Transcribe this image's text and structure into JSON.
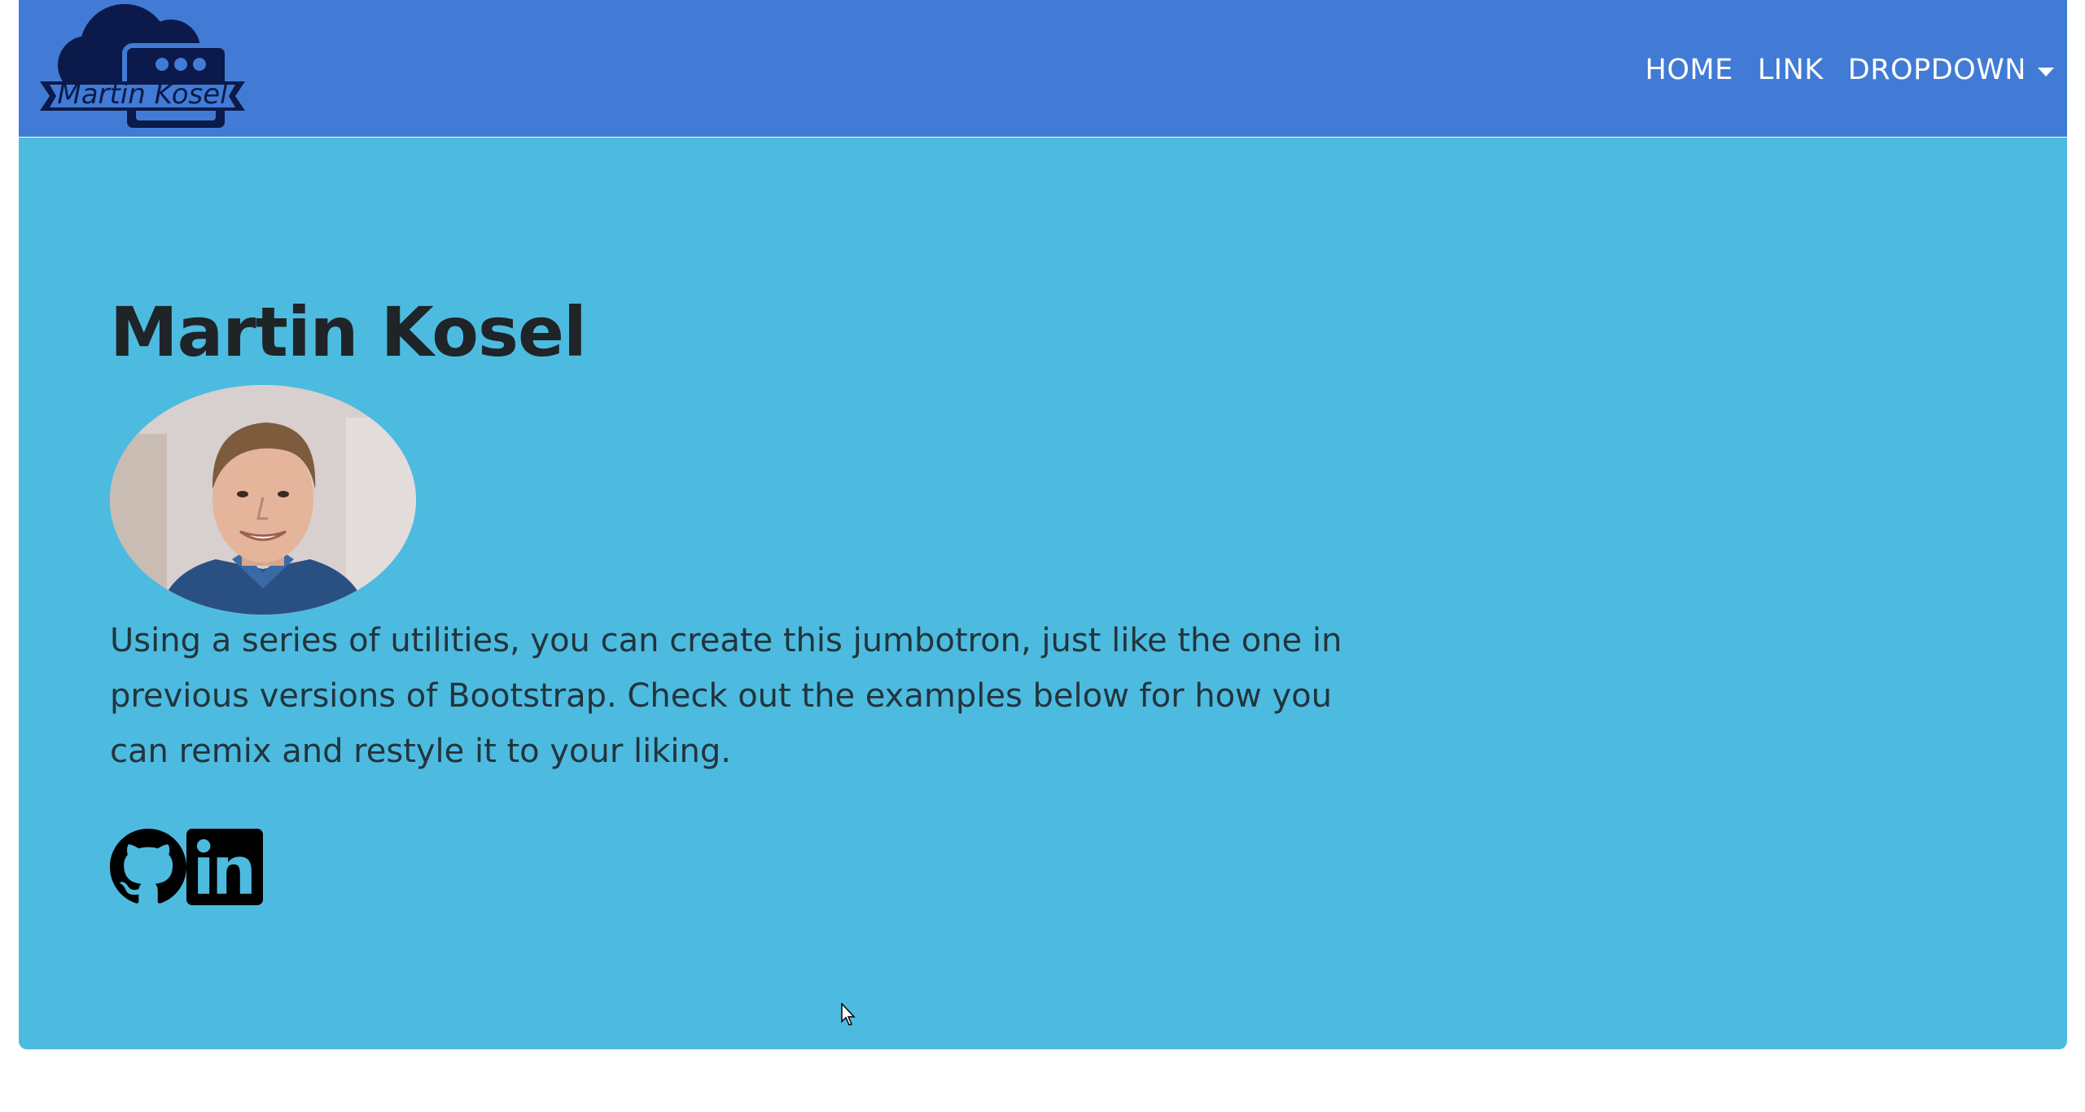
{
  "navbar": {
    "brand": {
      "logo_text": "Martin Kosel",
      "icon": "cloud-terminal-logo"
    },
    "links": [
      {
        "label": "HOME"
      },
      {
        "label": "LINK"
      },
      {
        "label": "DROPDOWN",
        "icon": "caret-down-icon"
      }
    ]
  },
  "jumbotron": {
    "title": "Martin Kosel",
    "lead": "Using a series of utilities, you can create this jumbotron, just like the one in previous versions of Bootstrap. Check out the examples below for how you can remix and restyle it to your liking.",
    "socials": [
      {
        "icon": "github-icon"
      },
      {
        "icon": "linkedin-icon"
      }
    ]
  },
  "colors": {
    "navbar_bg": "#417bd5",
    "jumbotron_bg": "#4dbbdf",
    "logo": "#0b1a4a",
    "title": "#1f2428"
  }
}
